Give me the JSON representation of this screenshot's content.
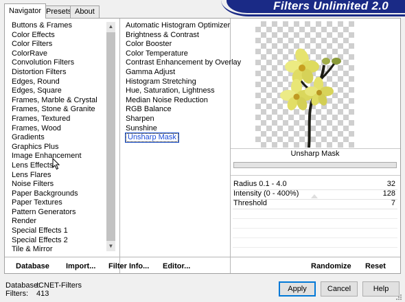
{
  "tabs": [
    "Navigator",
    "Presets",
    "About"
  ],
  "banner_title": "Filters Unlimited 2.0",
  "categories": [
    "Buttons & Frames",
    "Color Effects",
    "Color Filters",
    "ColorRave",
    "Convolution Filters",
    "Distortion Filters",
    "Edges, Round",
    "Edges, Square",
    "Frames, Marble & Crystal",
    "Frames, Stone & Granite",
    "Frames, Textured",
    "Frames, Wood",
    "Gradients",
    "Graphics Plus",
    "Image Enhancement",
    "Lens Effects",
    "Lens Flares",
    "Noise Filters",
    "Paper Backgrounds",
    "Paper Textures",
    "Pattern Generators",
    "Render",
    "Special Effects 1",
    "Special Effects 2",
    "Tile & Mirror"
  ],
  "filters": [
    "Automatic Histogram Optimizer",
    "Brightness & Contrast",
    "Color Booster",
    "Color Temperature",
    "Contrast Enhancement by Overlay",
    "Gamma Adjust",
    "Histogram Stretching",
    "Hue, Saturation, Lightness",
    "Median Noise Reduction",
    "RGB Balance",
    "Sharpen",
    "Sunshine"
  ],
  "selected_filter": "Unsharp Mask",
  "preview": {
    "filter_title": "Unsharp Mask",
    "progress": 0
  },
  "params": [
    {
      "label": "Radius 0.1 - 4.0",
      "value": "32"
    },
    {
      "label": "Intensity (0 - 400%)",
      "value": "128"
    },
    {
      "label": "Threshold",
      "value": "7"
    }
  ],
  "toolbar": {
    "database": "Database",
    "import": "Import...",
    "filter_info": "Filter Info...",
    "editor": "Editor...",
    "randomize": "Randomize",
    "reset": "Reset"
  },
  "info": {
    "database_label": "Database:",
    "database_value": "ICNET-Filters",
    "filters_label": "Filters:",
    "filters_value": "413"
  },
  "buttons": {
    "apply": "Apply",
    "cancel": "Cancel",
    "help": "Help"
  },
  "colors": {
    "banner": "#1a2a86",
    "selection_border": "#1a4bd8",
    "flower": "#e9e778"
  },
  "icons": {
    "cursor": "arrow-cursor-icon",
    "scroll_up": "scroll-up-icon",
    "scroll_down": "scroll-down-icon"
  }
}
